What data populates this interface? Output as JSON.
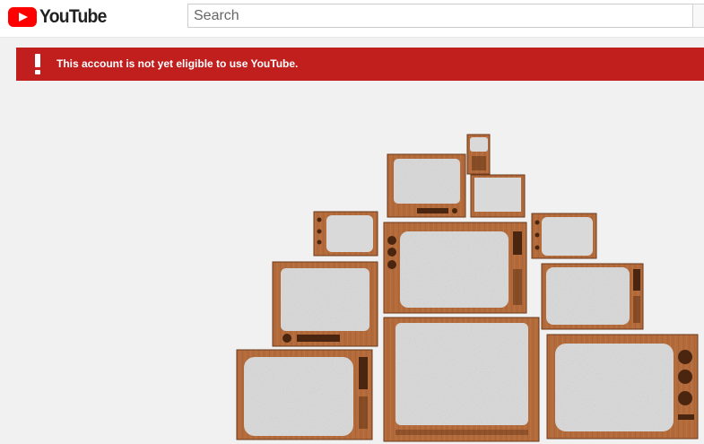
{
  "header": {
    "logo_text": "YouTube",
    "search_placeholder": "Search"
  },
  "alert": {
    "message": "This account is not yet eligible to use YouTube."
  },
  "colors": {
    "brand_red": "#ff0000",
    "alert_red": "#c11e1e",
    "wood": "#b36b3b",
    "screen": "#d9d9d9"
  },
  "icons": [
    "youtube-logo-icon",
    "exclamation-icon",
    "search-icon"
  ]
}
